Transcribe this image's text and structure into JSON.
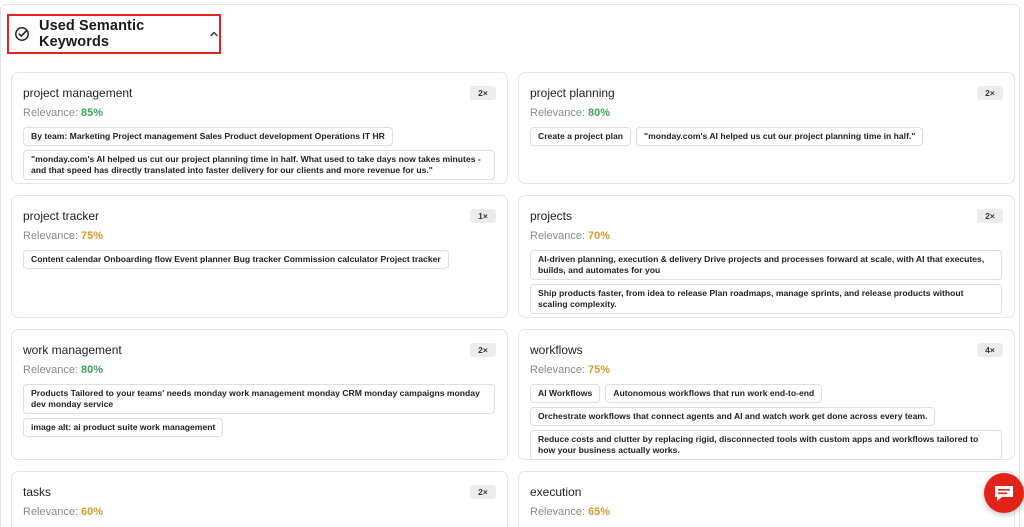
{
  "section": {
    "title": "Used Semantic Keywords"
  },
  "colors": {
    "high": "#3fa45c",
    "mid": "#d99a2b",
    "accent": "#e02424"
  },
  "keywords": [
    {
      "name": "project management",
      "count": "2×",
      "relevance_label": "Relevance:",
      "relevance": "85%",
      "level": "high",
      "snippets": [
        "By team: Marketing Project management Sales Product development Operations IT HR",
        "\"monday.com's AI helped us cut our project planning time in half. What used to take days now takes minutes - and that speed has directly translated into faster delivery for our clients and more revenue for us.\""
      ]
    },
    {
      "name": "project planning",
      "count": "2×",
      "relevance_label": "Relevance:",
      "relevance": "80%",
      "level": "high",
      "snippets": [
        "Create a project plan",
        "\"monday.com's AI helped us cut our project planning time in half.\""
      ]
    },
    {
      "name": "project tracker",
      "count": "1×",
      "relevance_label": "Relevance:",
      "relevance": "75%",
      "level": "mid",
      "snippets": [
        "Content calendar Onboarding flow Event planner Bug tracker Commission calculator Project tracker"
      ]
    },
    {
      "name": "projects",
      "count": "2×",
      "relevance_label": "Relevance:",
      "relevance": "70%",
      "level": "mid",
      "snippets": [
        "AI-driven planning, execution & delivery Drive projects and processes forward at scale, with AI that executes, builds, and automates for you",
        "Ship products faster, from idea to release Plan roadmaps, manage sprints, and release products without scaling complexity."
      ]
    },
    {
      "name": "work management",
      "count": "2×",
      "relevance_label": "Relevance:",
      "relevance": "80%",
      "level": "high",
      "snippets": [
        "Products Tailored to your teams' needs monday work management monday CRM monday campaigns monday dev monday service",
        "image alt: ai product suite work management"
      ]
    },
    {
      "name": "workflows",
      "count": "4×",
      "relevance_label": "Relevance:",
      "relevance": "75%",
      "level": "mid",
      "snippets": [
        "AI Workflows",
        "Autonomous workflows that run work end-to-end",
        "Orchestrate workflows that connect agents and AI and watch work get done across every team.",
        "Reduce costs and clutter by replacing rigid, disconnected tools with custom apps and workflows tailored to how your business actually works."
      ]
    },
    {
      "name": "tasks",
      "count": "2×",
      "relevance_label": "Relevance:",
      "relevance": "60%",
      "level": "mid",
      "snippets": []
    },
    {
      "name": "execution",
      "count": "",
      "relevance_label": "Relevance:",
      "relevance": "65%",
      "level": "mid",
      "snippets": []
    }
  ]
}
